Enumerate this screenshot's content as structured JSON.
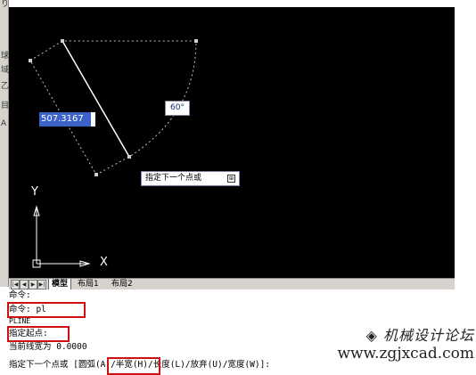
{
  "toolbar": {
    "icons": [
      "り",
      "球",
      "域",
      "乙",
      "目",
      "A"
    ]
  },
  "canvas": {
    "dimension_value": "507.3167",
    "angle_value": "60°",
    "prompt_text": "指定下一个点或",
    "prompt_icon": "⊞",
    "ucs_y": "Y",
    "ucs_x": "X"
  },
  "tabs": {
    "nav": [
      "|◀",
      "◀",
      "▶",
      "▶|"
    ],
    "items": [
      "模型",
      "布局1",
      "布局2"
    ]
  },
  "command_window": {
    "lines": [
      "命令:",
      "命令: pl",
      "PLINE",
      "指定起点:",
      "当前线宽为 0.0000",
      "指定下一个点或 [圆弧(A)/半宽(H)/长度(L)/放弃(U)/宽度(W)]:"
    ]
  },
  "watermark": {
    "title": "机械设计论坛",
    "url": "www.zgjxcad.com"
  },
  "colors": {
    "canvas_bg": "#000000",
    "highlight": "#d01010",
    "input_bg": "#3d63c9"
  }
}
